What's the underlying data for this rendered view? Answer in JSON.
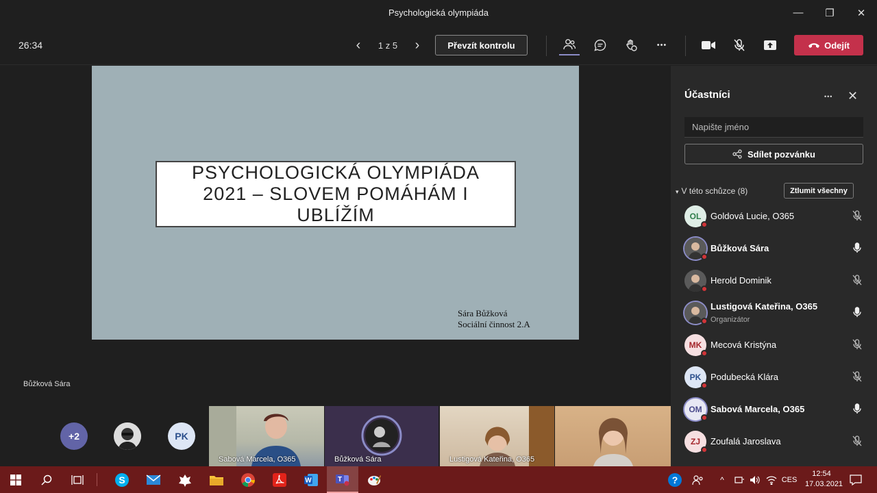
{
  "window": {
    "title": "Psychologická olympiáda",
    "minimize_glyph": "—",
    "maximize_glyph": "❐",
    "close_glyph": "✕"
  },
  "toolbar": {
    "timer": "26:34",
    "page_indicator": "1 z 5",
    "prev_glyph": "‹",
    "next_glyph": "›",
    "take_control_label": "Převzít kontrolu",
    "more_glyph": "•••",
    "leave_label": "Odejít",
    "icons": [
      "participants-icon",
      "chat-icon",
      "reactions-icon",
      "more-icon",
      "camera-icon",
      "mic-muted-icon",
      "share-icon",
      "hangup-icon"
    ]
  },
  "slide": {
    "title": "PSYCHOLOGICKÁ OLYMPIÁDA 2021 – SLOVEM POMÁHÁM I UBLÍŽÍM",
    "author": "Sára Bůžková",
    "class": "Sociální činnost 2.A",
    "background": "#9fb0b6"
  },
  "presenter_name": "Bůžková Sára",
  "gallery": {
    "overflow_count": "+2",
    "pk_initials": "PK",
    "tiles": [
      {
        "label": "Sabová Marcela, O365"
      },
      {
        "label": "Bůžková Sára"
      },
      {
        "label": "Lustigová Kateřina, O365"
      },
      {
        "label": ""
      }
    ]
  },
  "panel": {
    "title": "Účastníci",
    "more_glyph": "•••",
    "close_glyph": "✕",
    "search_placeholder": "Napište jméno",
    "invite_label": "Sdílet pozvánku",
    "section_label": "V této schůzce (8)",
    "section_chevron": "▾",
    "mute_all_label": "Ztlumit všechny",
    "participants": [
      {
        "name": "Goldová Lucie, O365",
        "initials": "OL",
        "avatar_bg": "#dfeee6",
        "avatar_fg": "#2e7d4a",
        "bold": false,
        "role": "",
        "muted": true
      },
      {
        "name": "Bůžková Sára",
        "initials": "",
        "avatar_bg": "#3a3a3a",
        "avatar_fg": "#fff",
        "bold": true,
        "role": "",
        "muted": false,
        "photo": true
      },
      {
        "name": "Herold Dominik",
        "initials": "",
        "avatar_bg": "#555",
        "avatar_fg": "#fff",
        "bold": false,
        "role": "",
        "muted": true,
        "photo": true
      },
      {
        "name": "Lustigová Kateřina, O365",
        "initials": "",
        "avatar_bg": "#7b6a50",
        "avatar_fg": "#fff",
        "bold": true,
        "role": "Organizátor",
        "muted": false,
        "photo": true
      },
      {
        "name": "Mecová Kristýna",
        "initials": "MK",
        "avatar_bg": "#f6dfe1",
        "avatar_fg": "#a4262c",
        "bold": false,
        "role": "",
        "muted": true
      },
      {
        "name": "Podubecká Klára",
        "initials": "PK",
        "avatar_bg": "#dde6f5",
        "avatar_fg": "#2b4f8c",
        "bold": false,
        "role": "",
        "muted": true
      },
      {
        "name": "Sabová Marcela, O365",
        "initials": "OM",
        "avatar_bg": "#e8e8f4",
        "avatar_fg": "#4b4b8c",
        "bold": true,
        "role": "",
        "muted": false
      },
      {
        "name": "Zoufalá Jaroslava",
        "initials": "ZJ",
        "avatar_bg": "#f6dfe1",
        "avatar_fg": "#a4262c",
        "bold": false,
        "role": "",
        "muted": true
      }
    ]
  },
  "taskbar": {
    "apps": [
      "start-icon",
      "search-icon",
      "task-view-icon",
      "skype-icon",
      "mail-icon",
      "app-icon",
      "file-explorer-icon",
      "chrome-icon",
      "acrobat-icon",
      "word-icon",
      "teams-icon",
      "paint-icon"
    ],
    "language": "CES",
    "time": "12:54",
    "date": "17.03.2021"
  },
  "colors": {
    "accent_red": "#c4314b",
    "teams_purple": "#6264a7",
    "taskbar": "#6b1a1a"
  }
}
